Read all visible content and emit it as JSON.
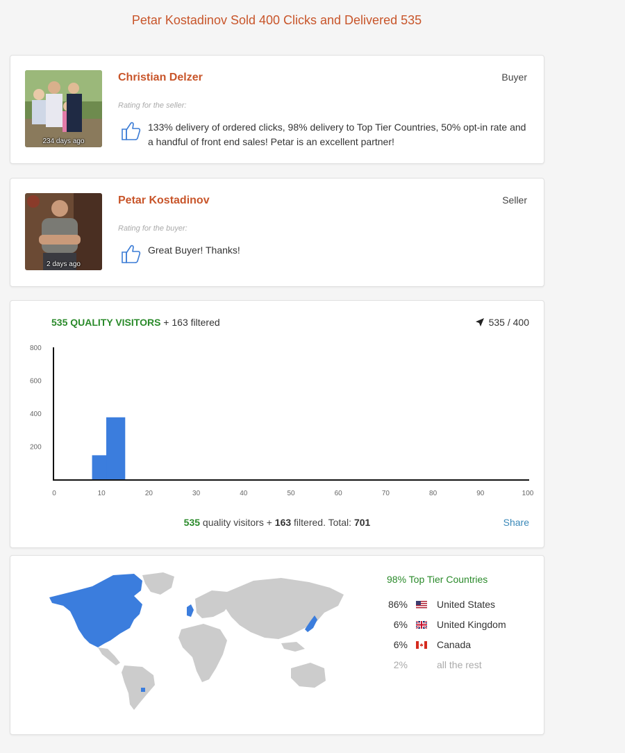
{
  "page": {
    "title": "Petar Kostadinov Sold 400 Clicks and Delivered 535"
  },
  "reviews": [
    {
      "name": "Christian Delzer",
      "role": "Buyer",
      "rating_label": "Rating for the seller:",
      "time_ago": "234 days ago",
      "text": "133% delivery of ordered clicks, 98% delivery to Top Tier Countries, 50% opt-in rate and a handful of front end sales! Petar is an excellent partner!"
    },
    {
      "name": "Petar Kostadinov",
      "role": "Seller",
      "rating_label": "Rating for the buyer:",
      "time_ago": "2 days ago",
      "text": "Great Buyer! Thanks!"
    }
  ],
  "visitors": {
    "quality_label": "535 QUALITY VISITORS",
    "filtered_label": " + 163 filtered",
    "ratio": "535 / 400",
    "summary": {
      "quality": "535",
      "quality_text": " quality visitors + ",
      "filtered": "163",
      "filtered_text": " filtered. Total: ",
      "total": "701"
    },
    "share_label": "Share"
  },
  "chart_data": {
    "type": "bar",
    "x": [
      10,
      13
    ],
    "values": [
      150,
      380
    ],
    "bar_width": 4,
    "xlim": [
      0,
      100
    ],
    "ylim": [
      0,
      800
    ],
    "x_ticks": [
      0,
      10,
      20,
      30,
      40,
      50,
      60,
      70,
      80,
      90,
      100
    ],
    "y_ticks": [
      200,
      400,
      600,
      800
    ],
    "color": "#3b7ddd",
    "grid": false
  },
  "geo": {
    "top_tier_label": "98% Top Tier Countries",
    "countries": [
      {
        "pct": "86%",
        "name": "United States",
        "flag": "us-flag-icon"
      },
      {
        "pct": "6%",
        "name": "United Kingdom",
        "flag": "uk-flag-icon"
      },
      {
        "pct": "6%",
        "name": "Canada",
        "flag": "ca-flag-icon"
      },
      {
        "pct": "2%",
        "name": "all the rest",
        "flag": ""
      }
    ],
    "highlight_color": "#3b7ddd",
    "land_color": "#cccccc"
  }
}
